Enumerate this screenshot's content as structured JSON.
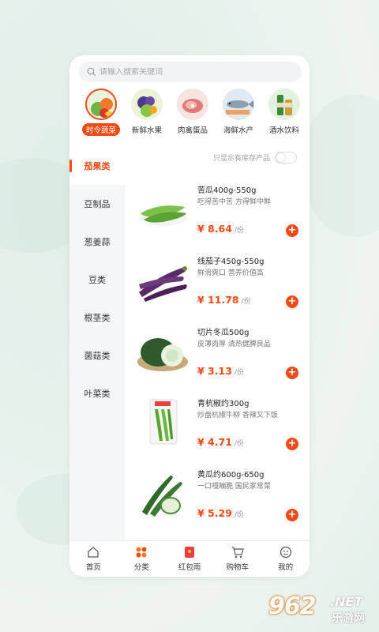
{
  "search": {
    "placeholder": "请输入搜索关键词"
  },
  "categories": [
    {
      "label": "时令蔬菜",
      "active": true
    },
    {
      "label": "新鲜水果",
      "active": false
    },
    {
      "label": "肉禽蛋品",
      "active": false
    },
    {
      "label": "海鲜水产",
      "active": false
    },
    {
      "label": "酒水饮料",
      "active": false
    }
  ],
  "sidebar": {
    "items": [
      {
        "label": "茄果类",
        "active": true
      },
      {
        "label": "豆制品"
      },
      {
        "label": "葱姜蒜"
      },
      {
        "label": "豆类"
      },
      {
        "label": "根茎类"
      },
      {
        "label": "菌菇类"
      },
      {
        "label": "叶菜类"
      }
    ]
  },
  "stock_filter": {
    "label": "只显示有库存产品",
    "on": false
  },
  "products": [
    {
      "name": "苦瓜400g-550g",
      "desc": "吃得苦中苦 方得鲜中鲜",
      "price": "¥ 8.64",
      "unit": "/份",
      "image": "bitter-melon"
    },
    {
      "name": "线茄子450g-550g",
      "desc": "鲜滑爽口 营养价值高",
      "price": "¥ 11.78",
      "unit": "/份",
      "image": "eggplant"
    },
    {
      "name": "切片冬瓜500g",
      "desc": "皮薄肉厚 清热健脾良品",
      "price": "¥ 3.13",
      "unit": "/份",
      "image": "winter-melon"
    },
    {
      "name": "青杭椒约300g",
      "desc": "炒盘杭椒牛柳 香辣又下饭",
      "price": "¥ 4.71",
      "unit": "/份",
      "image": "green-pepper"
    },
    {
      "name": "黄瓜约600g-650g",
      "desc": "一口嘎嘣脆 国民家常菜",
      "price": "¥ 5.29",
      "unit": "/份",
      "image": "cucumber"
    }
  ],
  "add_label": "+",
  "tabbar": [
    {
      "label": "首页",
      "icon": "home-icon"
    },
    {
      "label": "分类",
      "icon": "category-icon"
    },
    {
      "label": "红包雨",
      "icon": "red-envelope-icon"
    },
    {
      "label": "购物车",
      "icon": "cart-icon"
    },
    {
      "label": "我的",
      "icon": "profile-icon"
    }
  ],
  "watermark": {
    "logo": "962",
    "net": ".NET",
    "sub": "乐游网"
  },
  "colors": {
    "accent": "#f04a16",
    "sidebar_bg": "#f5f6f8"
  }
}
